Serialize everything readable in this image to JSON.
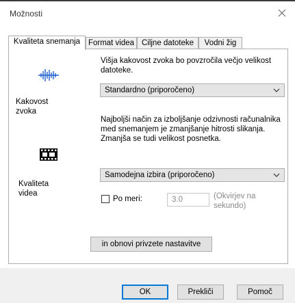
{
  "window": {
    "title": "Možnosti"
  },
  "tabs": [
    "Kvaliteta snemanja",
    "Format videa",
    "Ciljne datoteke",
    "Vodni žig"
  ],
  "audio": {
    "icon": "audio-waveform-icon",
    "label_line1": "Kakovost",
    "label_line2": "zvoka",
    "desc_line1": "Višja kakovost zvoka bo povzročila večjo velikost",
    "desc_line2": "datoteke.",
    "selected": "Standardno (priporočeno)"
  },
  "video": {
    "icon": "film-strip-icon",
    "label_line1": "Kvaliteta",
    "label_line2": "videa",
    "desc_line1": "Najboljši način za izboljšanje odzivnosti računalnika",
    "desc_line2": "med snemanjem je zmanjšanje hitrosti slikanja.",
    "desc_line3": "Zmanjša se tudi velikost posnetka.",
    "selected": "Samodejna izbira (priporočeno)",
    "custom_label": "Po meri:",
    "custom_value": "3.0",
    "custom_hint_line1": "(Okvirjev na",
    "custom_hint_line2": "sekundo)"
  },
  "restore_button": "in obnovi privzete nastavitve",
  "buttons": {
    "ok": "OK",
    "cancel": "Prekliči",
    "help": "Pomoč"
  }
}
